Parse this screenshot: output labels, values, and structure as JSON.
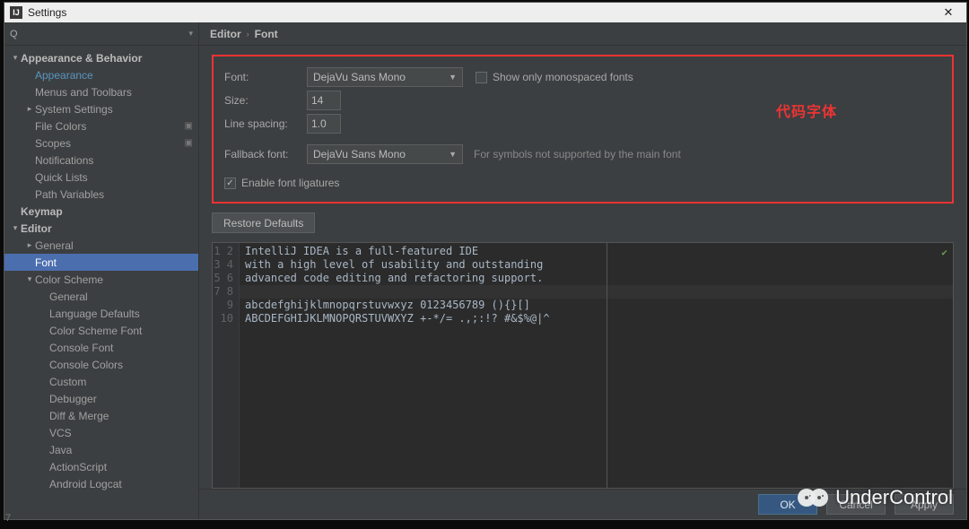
{
  "title": "Settings",
  "search": {
    "placeholder": "",
    "icon": "Q"
  },
  "breadcrumb": [
    "Editor",
    "Font"
  ],
  "sidebar": {
    "nodes": [
      {
        "depth": 0,
        "label": "Appearance & Behavior",
        "bold": true,
        "arrow": "▾"
      },
      {
        "depth": 1,
        "label": "Appearance",
        "link": true
      },
      {
        "depth": 1,
        "label": "Menus and Toolbars"
      },
      {
        "depth": 1,
        "label": "System Settings",
        "arrow": "▸"
      },
      {
        "depth": 1,
        "label": "File Colors",
        "proj": true
      },
      {
        "depth": 1,
        "label": "Scopes",
        "proj": true
      },
      {
        "depth": 1,
        "label": "Notifications"
      },
      {
        "depth": 1,
        "label": "Quick Lists"
      },
      {
        "depth": 1,
        "label": "Path Variables"
      },
      {
        "depth": 0,
        "label": "Keymap",
        "bold": true
      },
      {
        "depth": 0,
        "label": "Editor",
        "bold": true,
        "arrow": "▾"
      },
      {
        "depth": 1,
        "label": "General",
        "arrow": "▸"
      },
      {
        "depth": 1,
        "label": "Font",
        "sel": true
      },
      {
        "depth": 1,
        "label": "Color Scheme",
        "arrow": "▾"
      },
      {
        "depth": 2,
        "label": "General"
      },
      {
        "depth": 2,
        "label": "Language Defaults"
      },
      {
        "depth": 2,
        "label": "Color Scheme Font"
      },
      {
        "depth": 2,
        "label": "Console Font"
      },
      {
        "depth": 2,
        "label": "Console Colors"
      },
      {
        "depth": 2,
        "label": "Custom"
      },
      {
        "depth": 2,
        "label": "Debugger"
      },
      {
        "depth": 2,
        "label": "Diff & Merge"
      },
      {
        "depth": 2,
        "label": "VCS"
      },
      {
        "depth": 2,
        "label": "Java"
      },
      {
        "depth": 2,
        "label": "ActionScript"
      },
      {
        "depth": 2,
        "label": "Android Logcat"
      }
    ]
  },
  "font": {
    "font_label": "Font:",
    "font_value": "DejaVu Sans Mono",
    "show_only_label": "Show only monospaced fonts",
    "show_only_checked": false,
    "size_label": "Size:",
    "size_value": "14",
    "spacing_label": "Line spacing:",
    "spacing_value": "1.0",
    "fallback_label": "Fallback font:",
    "fallback_value": "DejaVu Sans Mono",
    "fallback_hint": "For symbols not supported by the main font",
    "ligatures_label": "Enable font ligatures",
    "ligatures_checked": true,
    "callout": "代码字体"
  },
  "restore_label": "Restore Defaults",
  "preview": {
    "lines": [
      "IntelliJ IDEA is a full-featured IDE",
      "with a high level of usability and outstanding",
      "advanced code editing and refactoring support.",
      "",
      "abcdefghijklmnopqrstuvwxyz 0123456789 (){}[]",
      "ABCDEFGHIJKLMNOPQRSTUVWXYZ +-*/= .,;:!? #&$%@|^",
      "",
      "",
      "",
      ""
    ],
    "highlight_line_index": 3,
    "margin_col": 56
  },
  "buttons": {
    "ok": "OK",
    "cancel": "Cancel",
    "apply": "Apply"
  },
  "watermark": "UnderControl",
  "status_left": "7"
}
